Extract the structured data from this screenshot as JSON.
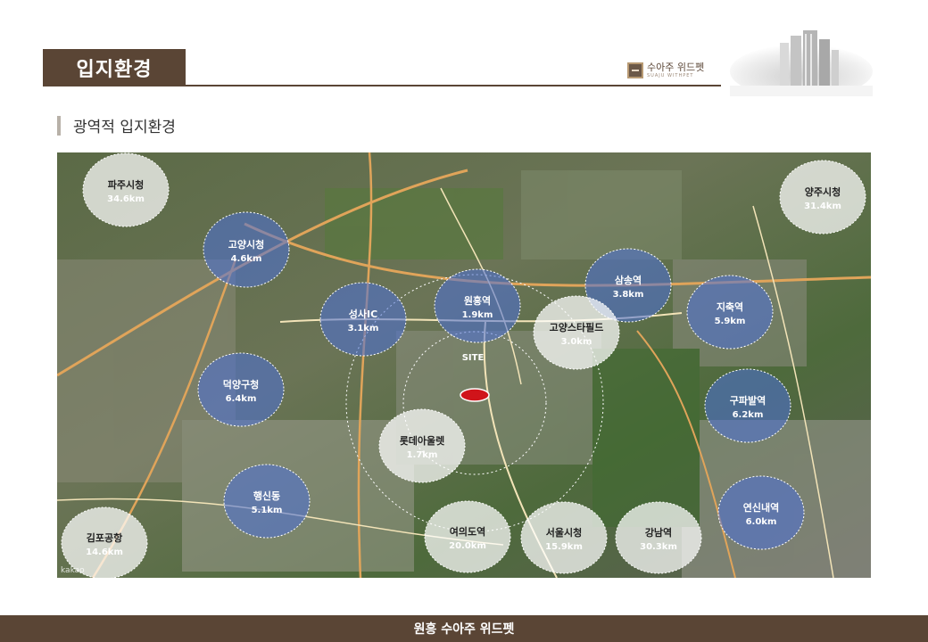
{
  "page": {
    "title": "입지환경",
    "subtitle": "광역적 입지환경",
    "footer": "원흥 수아주 위드펫"
  },
  "logo": {
    "name": "수아주 위드펫",
    "sub": "SUAJU WITHPET"
  },
  "map": {
    "site_label": "SITE",
    "attribution": "kakao",
    "destinations": [
      {
        "id": "paju",
        "name": "파주시청",
        "distance": "34.6km",
        "style": "white"
      },
      {
        "id": "goyang",
        "name": "고양시청",
        "distance": "4.6km",
        "style": "blue"
      },
      {
        "id": "seongsa",
        "name": "성사IC",
        "distance": "3.1km",
        "style": "blue"
      },
      {
        "id": "wonheung",
        "name": "원흥역",
        "distance": "1.9km",
        "style": "blue"
      },
      {
        "id": "samsong",
        "name": "삼송역",
        "distance": "3.8km",
        "style": "blue"
      },
      {
        "id": "jichuk",
        "name": "지축역",
        "distance": "5.9km",
        "style": "blue"
      },
      {
        "id": "yangju",
        "name": "양주시청",
        "distance": "31.4km",
        "style": "white"
      },
      {
        "id": "starfield",
        "name": "고양스타필드",
        "distance": "3.0km",
        "style": "white"
      },
      {
        "id": "deogyang",
        "name": "덕양구청",
        "distance": "6.4km",
        "style": "blue"
      },
      {
        "id": "gupabal",
        "name": "구파발역",
        "distance": "6.2km",
        "style": "blue"
      },
      {
        "id": "lotte",
        "name": "롯데아울렛",
        "distance": "1.7km",
        "style": "white"
      },
      {
        "id": "haengsin",
        "name": "행신동",
        "distance": "5.1km",
        "style": "blue"
      },
      {
        "id": "yeonsinnae",
        "name": "연신내역",
        "distance": "6.0km",
        "style": "blue"
      },
      {
        "id": "gimpo",
        "name": "김포공항",
        "distance": "14.6km",
        "style": "white"
      },
      {
        "id": "yeouido",
        "name": "여의도역",
        "distance": "20.0km",
        "style": "white"
      },
      {
        "id": "seoul",
        "name": "서울시청",
        "distance": "15.9km",
        "style": "white"
      },
      {
        "id": "gangnam",
        "name": "강남역",
        "distance": "30.3km",
        "style": "white"
      }
    ]
  },
  "colors": {
    "brand_brown": "#5a4535",
    "blue_circle": "#4a6fd8",
    "white_circle": "#ffffff",
    "site_marker": "#d0141a"
  }
}
